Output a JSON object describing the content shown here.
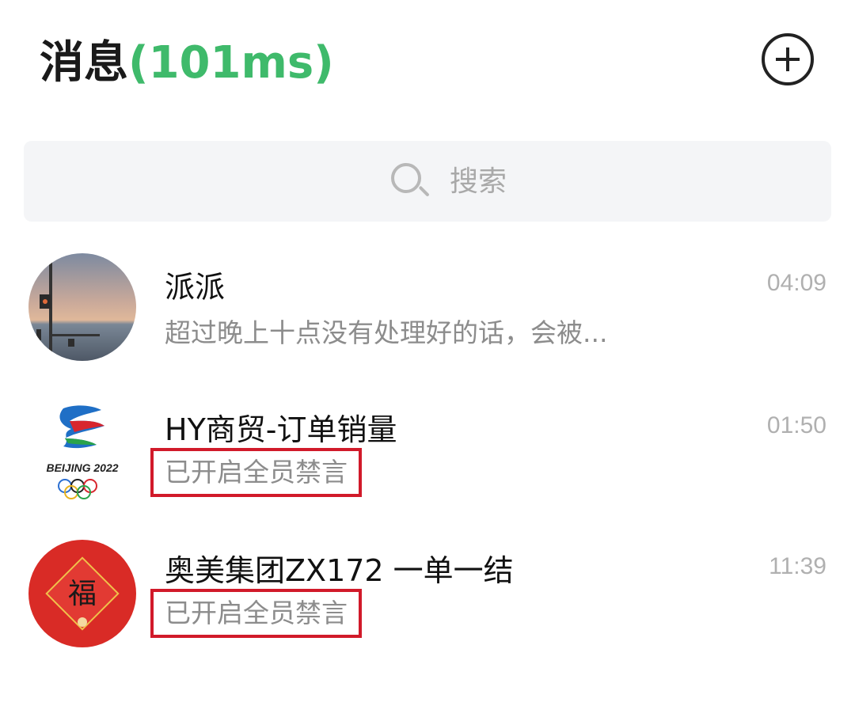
{
  "header": {
    "title": "消息",
    "latency": "(101ms)"
  },
  "search": {
    "placeholder": "搜索"
  },
  "chats": [
    {
      "name": "派派",
      "time": "04:09",
      "preview": "超过晚上十点没有处理好的话，会被..."
    },
    {
      "name": "HY商贸-订单销量",
      "time": "01:50",
      "preview": "已开启全员禁言",
      "avatar_text": "BEIJING 2022"
    },
    {
      "name": "奥美集团ZX172 一单一结",
      "time": "11:39",
      "preview": "已开启全员禁言",
      "avatar_text": "福"
    }
  ],
  "colors": {
    "accent_green": "#3fba6b",
    "highlight_red": "#d11a2a",
    "muted_text": "#8c8c8c"
  }
}
